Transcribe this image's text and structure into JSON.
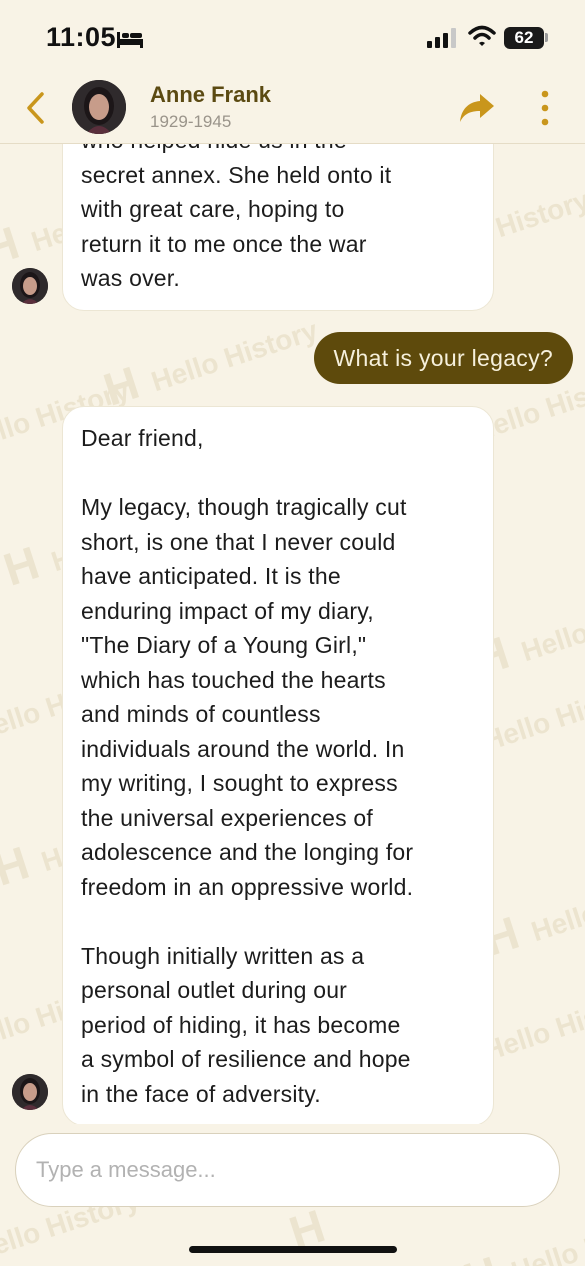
{
  "status_bar": {
    "time": "11:05",
    "battery": "62"
  },
  "header": {
    "name": "Anne Frank",
    "years": "1929-1945"
  },
  "messages": [
    {
      "sender": "bot",
      "text": "who helped hide us in the\nsecret annex. She held onto it\nwith great care, hoping to\nreturn it to me once the war\nwas over."
    },
    {
      "sender": "user",
      "text": "What is your legacy?"
    },
    {
      "sender": "bot",
      "text": "Dear friend,\n\nMy legacy, though tragically cut\nshort, is one that I never could\nhave anticipated. It is the\nenduring impact of my diary,\n\"The Diary of a Young Girl,\"\nwhich has touched the hearts\nand minds of countless\nindividuals around the world. In\nmy writing, I sought to express\nthe universal experiences of\nadolescence and the longing for\nfreedom in an oppressive world.\n\nThough initially written as a\npersonal outlet during our\nperiod of hiding, it has become\na symbol of resilience and hope\nin the face of adversity."
    }
  ],
  "composer": {
    "placeholder": "Type a message..."
  },
  "watermark": {
    "letter": "H",
    "text": "Hello History"
  },
  "icons": {
    "back": "chevron-left-icon",
    "share": "share-arrow-icon",
    "more": "more-vertical-icon",
    "sleep": "bed-icon",
    "signal": "signal-icon",
    "wifi": "wifi-icon"
  },
  "colors": {
    "background": "#f8f3e6",
    "accent": "#c9961c",
    "brand_dark": "#5e4a0c",
    "name_text": "#5b4a12"
  }
}
